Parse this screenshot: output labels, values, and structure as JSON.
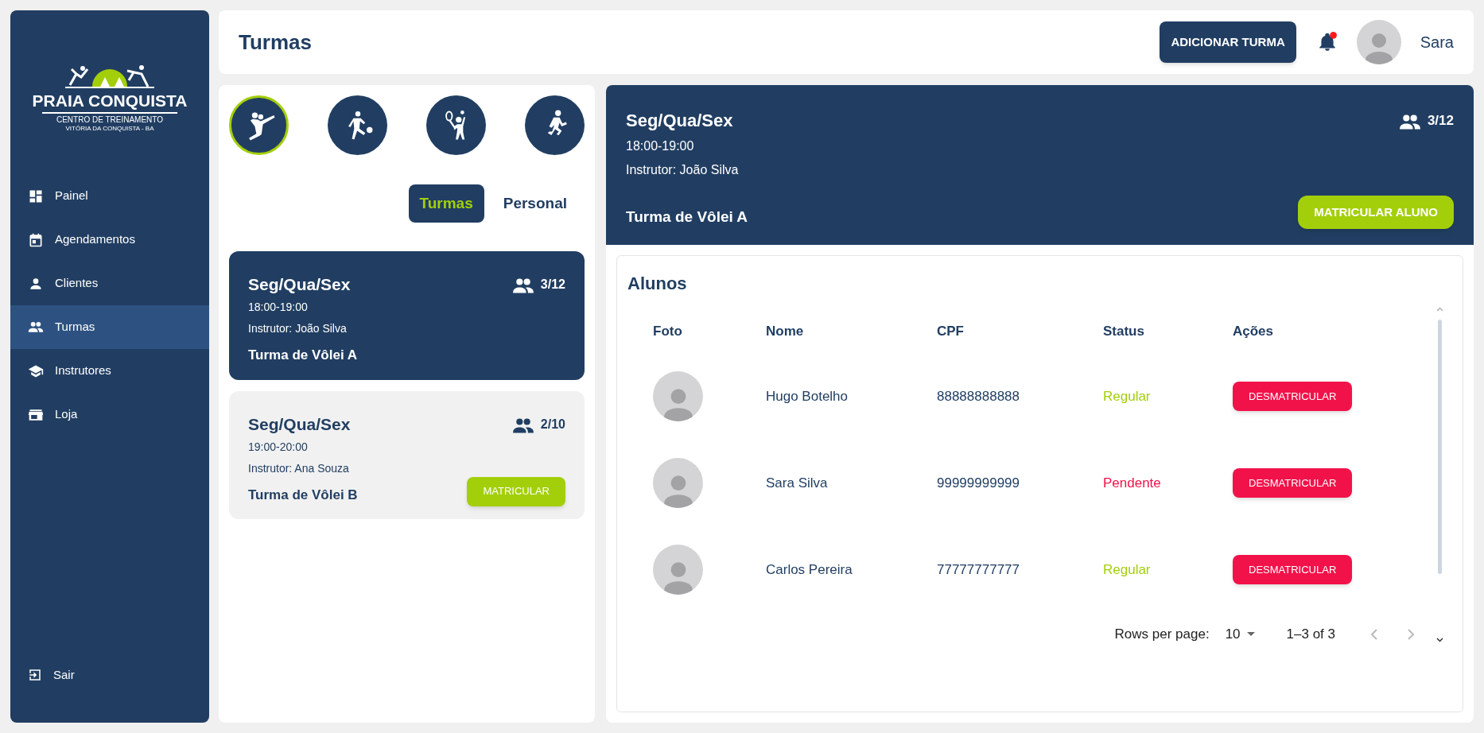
{
  "sidebar": {
    "logo": {
      "title": "PRAIA CONQUISTA",
      "subtitle": "CENTRO DE TREINAMENTO",
      "location": "VITÓRIA DA CONQUISTA - BA"
    },
    "items": [
      {
        "label": "Painel",
        "kind": "dashboard",
        "selected": false
      },
      {
        "label": "Agendamentos",
        "kind": "calendar",
        "selected": false
      },
      {
        "label": "Clientes",
        "kind": "person",
        "selected": false
      },
      {
        "label": "Turmas",
        "kind": "people",
        "selected": true
      },
      {
        "label": "Instrutores",
        "kind": "school",
        "selected": false
      },
      {
        "label": "Loja",
        "kind": "store",
        "selected": false
      }
    ],
    "logout": {
      "label": "Sair"
    }
  },
  "header": {
    "title": "Turmas",
    "add_button": "ADICIONAR TURMA",
    "notification": {
      "unread": true
    },
    "user": {
      "name": "Sara"
    }
  },
  "sports": [
    {
      "kind": "volleyball",
      "selected": true
    },
    {
      "kind": "soccer",
      "selected": false
    },
    {
      "kind": "tennis",
      "selected": false
    },
    {
      "kind": "running",
      "selected": false
    }
  ],
  "view_tabs": [
    {
      "label": "Turmas",
      "selected": true
    },
    {
      "label": "Personal",
      "selected": false
    }
  ],
  "classes": [
    {
      "days": "Seg/Qua/Sex",
      "time": "18:00-19:00",
      "instructor": "Instrutor: João Silva",
      "name": "Turma de Vôlei A",
      "enrolled": "3/12",
      "selected": true
    },
    {
      "days": "Seg/Qua/Sex",
      "time": "19:00-20:00",
      "instructor": "Instrutor: Ana Souza",
      "name": "Turma de Vôlei B",
      "enrolled": "2/10",
      "selected": false,
      "button": "MATRICULAR"
    }
  ],
  "detail": {
    "days": "Seg/Qua/Sex",
    "time": "18:00-19:00",
    "instructor": "Instrutor: João Silva",
    "name": "Turma de Vôlei A",
    "enrolled": "3/12",
    "button": "MATRICULAR ALUNO"
  },
  "students": {
    "title": "Alunos",
    "columns": [
      "Foto",
      "Nome",
      "CPF",
      "Status",
      "Ações"
    ],
    "rows": [
      {
        "name": "Hugo Botelho",
        "cpf": "88888888888",
        "status": "Regular",
        "color": "#a3cf0a",
        "action": "DESMATRICULAR"
      },
      {
        "name": "Sara Silva",
        "cpf": "99999999999",
        "status": "Pendente",
        "color": "#f2124a",
        "action": "DESMATRICULAR"
      },
      {
        "name": "Carlos Pereira",
        "cpf": "77777777777",
        "status": "Regular",
        "color": "#a3cf0a",
        "action": "DESMATRICULAR"
      }
    ],
    "pagination": {
      "rows_label": "Rows per page:",
      "rows_value": "10",
      "range": "1–3 of 3"
    }
  }
}
